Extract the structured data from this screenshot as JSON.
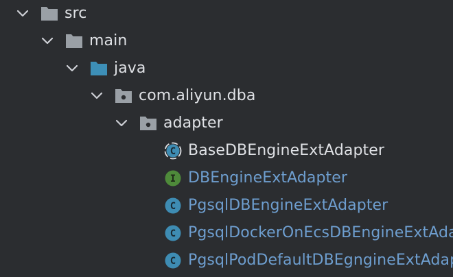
{
  "colors": {
    "background": "#2b2d30",
    "text_default": "#dfe1e5",
    "text_vcs_modified": "#6e9ecf",
    "chevron": "#ced0d6",
    "folder_gray": "#9aa0a6",
    "folder_blue": "#3d8fb7",
    "class_icon": "#3e8cb3",
    "interface_icon": "#4e8a3a"
  },
  "tree": [
    {
      "label": "src",
      "icon": "folder-icon",
      "expanded": true,
      "level": 0,
      "modified": false
    },
    {
      "label": "main",
      "icon": "folder-icon",
      "expanded": true,
      "level": 1,
      "modified": false
    },
    {
      "label": "java",
      "icon": "source-root-folder-icon",
      "expanded": true,
      "level": 2,
      "modified": false
    },
    {
      "label": "com.aliyun.dba",
      "icon": "package-folder-icon",
      "expanded": true,
      "level": 3,
      "modified": false
    },
    {
      "label": "adapter",
      "icon": "package-folder-icon",
      "expanded": true,
      "level": 4,
      "modified": false
    },
    {
      "label": "BaseDBEngineExtAdapter",
      "icon": "abstract-class-icon",
      "glyph": "C",
      "level": 5,
      "modified": false
    },
    {
      "label": "DBEngineExtAdapter",
      "icon": "interface-icon",
      "glyph": "I",
      "level": 5,
      "modified": true
    },
    {
      "label": "PgsqlDBEngineExtAdapter",
      "icon": "class-icon",
      "glyph": "C",
      "level": 5,
      "modified": true
    },
    {
      "label": "PgsqlDockerOnEcsDBEngineExtAdapter",
      "icon": "class-icon",
      "glyph": "C",
      "level": 5,
      "modified": true
    },
    {
      "label": "PgsqlPodDefaultDBEgngineExtAdapter",
      "icon": "class-icon",
      "glyph": "C",
      "level": 5,
      "modified": true
    }
  ]
}
